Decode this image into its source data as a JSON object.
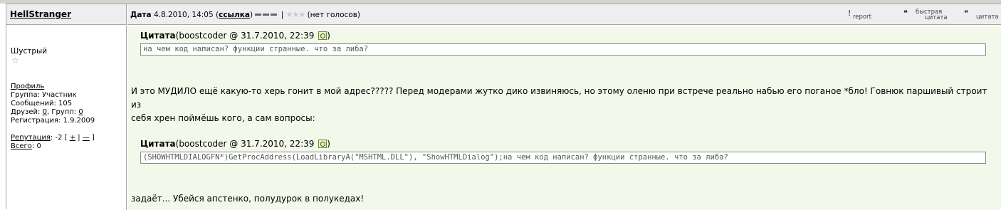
{
  "post": {
    "author": "HellStranger",
    "meta": {
      "date_label": "Дата",
      "date_value": "4.8.2010, 14:05",
      "link_label": "ссылка",
      "separator": "|",
      "votes_text": "(нет голосов)"
    },
    "actions": [
      {
        "id": "report",
        "line1": "report",
        "line2": ""
      },
      {
        "id": "quick-quote",
        "line1": "быстрая",
        "line2": "цитата"
      },
      {
        "id": "quote",
        "line1": "цитата",
        "line2": ""
      }
    ],
    "user": {
      "rank": "Шустрый",
      "profile_label": "Профиль",
      "group": "Группа: Участник",
      "messages": "Сообщений: 105",
      "friends_label": "Друзей:",
      "friends_value": "0",
      "groups_label": "Групп:",
      "groups_value": "0",
      "registered": "Регистрация: 1.9.2009",
      "reputation_label": "Репутация",
      "reputation_value": ": -2 [",
      "rep_plus": "+",
      "rep_sep": "|",
      "rep_minus": "—",
      "rep_close": "]",
      "total_label": "Всего",
      "total_value": ": 0"
    },
    "content": {
      "quote1": {
        "title": "Цитата",
        "source": "(boostcoder @  31.7.2010, 22:39 ",
        "close": ")",
        "text": "на чем код написан? функции странные. что за либа?"
      },
      "paragraph1_line1": "И это МУДИЛО ещё какую-то херь гонит в мой адрес????? Перед модерами жутко дико извиняюсь, но этому оленю при встрече реально набью его поганое *бло! Говнюк паршивый строит из",
      "paragraph1_line2": "себя хрен поймёшь кого, а сам вопросы:",
      "quote2": {
        "title": "Цитата",
        "source": "(boostcoder @  31.7.2010, 22:39 ",
        "close": ")",
        "text": "(SHOWHTMLDIALOGFN*)GetProcAddress(LoadLibraryA(\"MSHTML.DLL\"), \"ShowHTMLDialog\");на чем код написан? функции странные. что за либа?"
      },
      "paragraph2": "задаёт... Убейся апстенко, полудурок в полукедах!"
    },
    "colors": {
      "content_bg": "#f2f9ea",
      "header_bg": "#eeeeee",
      "border": "#a6a6a6"
    }
  }
}
